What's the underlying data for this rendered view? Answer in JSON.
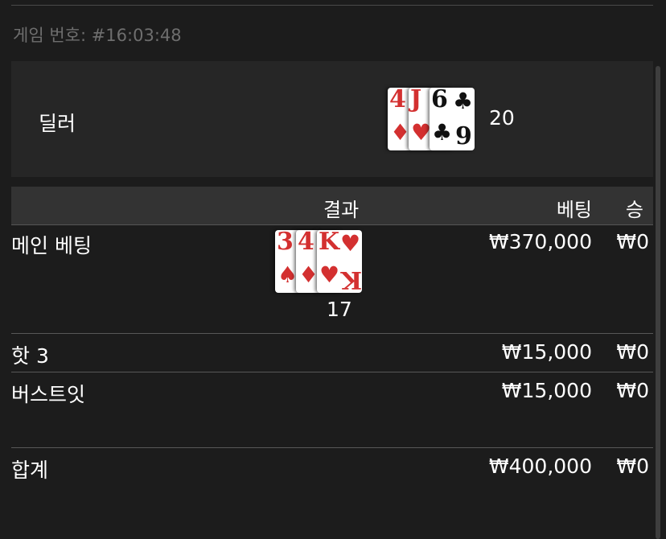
{
  "game_id": "게임 번호: #16:03:48",
  "dealer": {
    "label": "딜러",
    "cards": [
      {
        "rank": "4",
        "suit": "♦"
      },
      {
        "rank": "J",
        "suit": "♥"
      },
      {
        "rank": "6",
        "suit": "♣"
      }
    ],
    "bottom_rank": "9",
    "total": "20"
  },
  "table": {
    "headers": {
      "result": "결과",
      "bet": "베팅",
      "win": "승"
    },
    "main": {
      "label": "메인 베팅",
      "cards": [
        {
          "rank": "3",
          "suit": "♠"
        },
        {
          "rank": "4",
          "suit": "♦"
        },
        {
          "rank": "K",
          "suit": "♥"
        }
      ],
      "total": "17",
      "bet": "₩370,000",
      "win": "₩0"
    },
    "hot3": {
      "label": "핫 3",
      "bet": "₩15,000",
      "win": "₩0"
    },
    "bustit": {
      "label": "버스트잇",
      "bet": "₩15,000",
      "win": "₩0"
    },
    "total": {
      "label": "합계",
      "bet": "₩400,000",
      "win": "₩0"
    }
  },
  "colors": {
    "background": "#1c1c1c",
    "panel": "#262626",
    "header": "#333333",
    "card_red": "#d33030"
  }
}
